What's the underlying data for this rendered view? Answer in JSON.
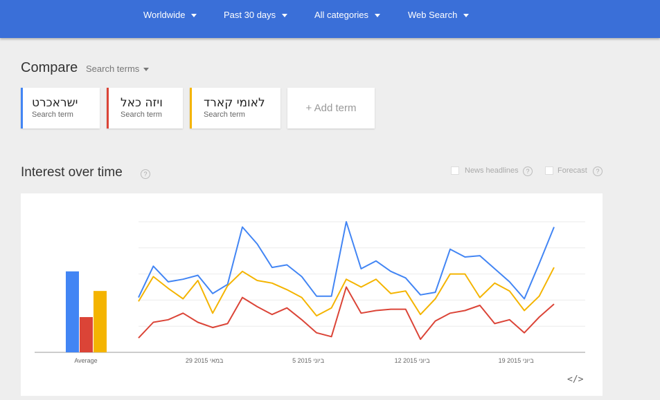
{
  "filters": {
    "region": "Worldwide",
    "time": "Past 30 days",
    "category": "All categories",
    "search_type": "Web Search"
  },
  "compare": {
    "title": "Compare",
    "dropdown": "Search terms"
  },
  "terms": [
    {
      "label": "ישראכרט",
      "sub": "Search term",
      "color": "#4285f4"
    },
    {
      "label": "ויזה כאל",
      "sub": "Search term",
      "color": "#db4437"
    },
    {
      "label": "לאומי קארד",
      "sub": "Search term",
      "color": "#f4b400"
    }
  ],
  "add_term": "+ Add term",
  "interest": {
    "title": "Interest over time",
    "help": "?",
    "news_headlines": "News headlines",
    "forecast": "Forecast"
  },
  "embed_icon": "</>",
  "chart_data": {
    "type": "line",
    "ylim": [
      0,
      100
    ],
    "grid": true,
    "average_label": "Average",
    "averages": [
      62,
      27,
      47
    ],
    "x_tick_labels": [
      "29 במאי 2015",
      "5 ביוני 2015",
      "12 ביוני 2015",
      "19 ביוני 2015"
    ],
    "x_tick_index": [
      5,
      12,
      19,
      26
    ],
    "series": [
      {
        "name": "ישראכרט",
        "color": "#4285f4",
        "values": [
          42,
          66,
          54,
          56,
          59,
          45,
          52,
          96,
          83,
          65,
          67,
          58,
          43,
          43,
          100,
          64,
          70,
          62,
          57,
          44,
          46,
          79,
          73,
          74,
          64,
          54,
          41,
          68,
          96
        ]
      },
      {
        "name": "ויזה כאל",
        "color": "#db4437",
        "values": [
          11,
          23,
          25,
          30,
          23,
          19,
          22,
          42,
          35,
          29,
          34,
          25,
          15,
          12,
          50,
          30,
          32,
          33,
          33,
          10,
          24,
          30,
          32,
          36,
          22,
          25,
          15,
          27,
          37
        ]
      },
      {
        "name": "לאומי קארד",
        "color": "#f4b400",
        "values": [
          39,
          58,
          49,
          41,
          55,
          30,
          51,
          62,
          55,
          53,
          48,
          42,
          28,
          34,
          56,
          50,
          56,
          45,
          47,
          29,
          41,
          60,
          60,
          42,
          53,
          47,
          32,
          43,
          65
        ]
      }
    ]
  }
}
